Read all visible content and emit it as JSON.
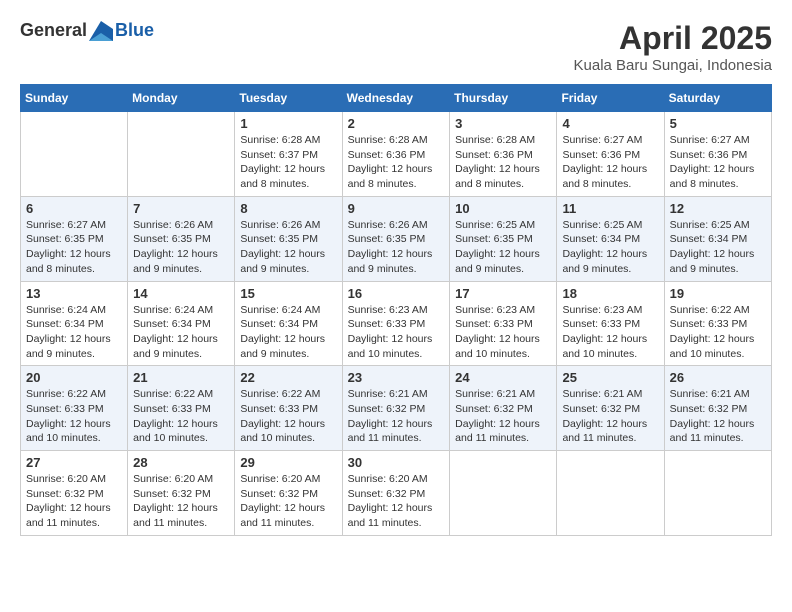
{
  "header": {
    "logo_general": "General",
    "logo_blue": "Blue",
    "title": "April 2025",
    "subtitle": "Kuala Baru Sungai, Indonesia"
  },
  "calendar": {
    "weekdays": [
      "Sunday",
      "Monday",
      "Tuesday",
      "Wednesday",
      "Thursday",
      "Friday",
      "Saturday"
    ],
    "weeks": [
      [
        {
          "day": "",
          "sunrise": "",
          "sunset": "",
          "daylight": ""
        },
        {
          "day": "",
          "sunrise": "",
          "sunset": "",
          "daylight": ""
        },
        {
          "day": "1",
          "sunrise": "Sunrise: 6:28 AM",
          "sunset": "Sunset: 6:37 PM",
          "daylight": "Daylight: 12 hours and 8 minutes."
        },
        {
          "day": "2",
          "sunrise": "Sunrise: 6:28 AM",
          "sunset": "Sunset: 6:36 PM",
          "daylight": "Daylight: 12 hours and 8 minutes."
        },
        {
          "day": "3",
          "sunrise": "Sunrise: 6:28 AM",
          "sunset": "Sunset: 6:36 PM",
          "daylight": "Daylight: 12 hours and 8 minutes."
        },
        {
          "day": "4",
          "sunrise": "Sunrise: 6:27 AM",
          "sunset": "Sunset: 6:36 PM",
          "daylight": "Daylight: 12 hours and 8 minutes."
        },
        {
          "day": "5",
          "sunrise": "Sunrise: 6:27 AM",
          "sunset": "Sunset: 6:36 PM",
          "daylight": "Daylight: 12 hours and 8 minutes."
        }
      ],
      [
        {
          "day": "6",
          "sunrise": "Sunrise: 6:27 AM",
          "sunset": "Sunset: 6:35 PM",
          "daylight": "Daylight: 12 hours and 8 minutes."
        },
        {
          "day": "7",
          "sunrise": "Sunrise: 6:26 AM",
          "sunset": "Sunset: 6:35 PM",
          "daylight": "Daylight: 12 hours and 9 minutes."
        },
        {
          "day": "8",
          "sunrise": "Sunrise: 6:26 AM",
          "sunset": "Sunset: 6:35 PM",
          "daylight": "Daylight: 12 hours and 9 minutes."
        },
        {
          "day": "9",
          "sunrise": "Sunrise: 6:26 AM",
          "sunset": "Sunset: 6:35 PM",
          "daylight": "Daylight: 12 hours and 9 minutes."
        },
        {
          "day": "10",
          "sunrise": "Sunrise: 6:25 AM",
          "sunset": "Sunset: 6:35 PM",
          "daylight": "Daylight: 12 hours and 9 minutes."
        },
        {
          "day": "11",
          "sunrise": "Sunrise: 6:25 AM",
          "sunset": "Sunset: 6:34 PM",
          "daylight": "Daylight: 12 hours and 9 minutes."
        },
        {
          "day": "12",
          "sunrise": "Sunrise: 6:25 AM",
          "sunset": "Sunset: 6:34 PM",
          "daylight": "Daylight: 12 hours and 9 minutes."
        }
      ],
      [
        {
          "day": "13",
          "sunrise": "Sunrise: 6:24 AM",
          "sunset": "Sunset: 6:34 PM",
          "daylight": "Daylight: 12 hours and 9 minutes."
        },
        {
          "day": "14",
          "sunrise": "Sunrise: 6:24 AM",
          "sunset": "Sunset: 6:34 PM",
          "daylight": "Daylight: 12 hours and 9 minutes."
        },
        {
          "day": "15",
          "sunrise": "Sunrise: 6:24 AM",
          "sunset": "Sunset: 6:34 PM",
          "daylight": "Daylight: 12 hours and 9 minutes."
        },
        {
          "day": "16",
          "sunrise": "Sunrise: 6:23 AM",
          "sunset": "Sunset: 6:33 PM",
          "daylight": "Daylight: 12 hours and 10 minutes."
        },
        {
          "day": "17",
          "sunrise": "Sunrise: 6:23 AM",
          "sunset": "Sunset: 6:33 PM",
          "daylight": "Daylight: 12 hours and 10 minutes."
        },
        {
          "day": "18",
          "sunrise": "Sunrise: 6:23 AM",
          "sunset": "Sunset: 6:33 PM",
          "daylight": "Daylight: 12 hours and 10 minutes."
        },
        {
          "day": "19",
          "sunrise": "Sunrise: 6:22 AM",
          "sunset": "Sunset: 6:33 PM",
          "daylight": "Daylight: 12 hours and 10 minutes."
        }
      ],
      [
        {
          "day": "20",
          "sunrise": "Sunrise: 6:22 AM",
          "sunset": "Sunset: 6:33 PM",
          "daylight": "Daylight: 12 hours and 10 minutes."
        },
        {
          "day": "21",
          "sunrise": "Sunrise: 6:22 AM",
          "sunset": "Sunset: 6:33 PM",
          "daylight": "Daylight: 12 hours and 10 minutes."
        },
        {
          "day": "22",
          "sunrise": "Sunrise: 6:22 AM",
          "sunset": "Sunset: 6:33 PM",
          "daylight": "Daylight: 12 hours and 10 minutes."
        },
        {
          "day": "23",
          "sunrise": "Sunrise: 6:21 AM",
          "sunset": "Sunset: 6:32 PM",
          "daylight": "Daylight: 12 hours and 11 minutes."
        },
        {
          "day": "24",
          "sunrise": "Sunrise: 6:21 AM",
          "sunset": "Sunset: 6:32 PM",
          "daylight": "Daylight: 12 hours and 11 minutes."
        },
        {
          "day": "25",
          "sunrise": "Sunrise: 6:21 AM",
          "sunset": "Sunset: 6:32 PM",
          "daylight": "Daylight: 12 hours and 11 minutes."
        },
        {
          "day": "26",
          "sunrise": "Sunrise: 6:21 AM",
          "sunset": "Sunset: 6:32 PM",
          "daylight": "Daylight: 12 hours and 11 minutes."
        }
      ],
      [
        {
          "day": "27",
          "sunrise": "Sunrise: 6:20 AM",
          "sunset": "Sunset: 6:32 PM",
          "daylight": "Daylight: 12 hours and 11 minutes."
        },
        {
          "day": "28",
          "sunrise": "Sunrise: 6:20 AM",
          "sunset": "Sunset: 6:32 PM",
          "daylight": "Daylight: 12 hours and 11 minutes."
        },
        {
          "day": "29",
          "sunrise": "Sunrise: 6:20 AM",
          "sunset": "Sunset: 6:32 PM",
          "daylight": "Daylight: 12 hours and 11 minutes."
        },
        {
          "day": "30",
          "sunrise": "Sunrise: 6:20 AM",
          "sunset": "Sunset: 6:32 PM",
          "daylight": "Daylight: 12 hours and 11 minutes."
        },
        {
          "day": "",
          "sunrise": "",
          "sunset": "",
          "daylight": ""
        },
        {
          "day": "",
          "sunrise": "",
          "sunset": "",
          "daylight": ""
        },
        {
          "day": "",
          "sunrise": "",
          "sunset": "",
          "daylight": ""
        }
      ]
    ]
  }
}
